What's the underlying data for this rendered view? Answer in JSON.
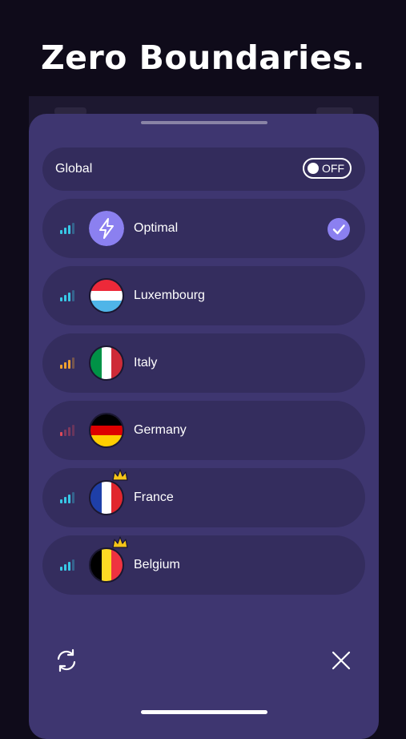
{
  "headline": "Zero Boundaries.",
  "global": {
    "label": "Global",
    "toggle_text": "OFF",
    "toggle_on": false
  },
  "servers": [
    {
      "name": "Optimal",
      "icon": "lightning-icon",
      "signal_color": "#38c8e6",
      "selected": true,
      "premium": false
    },
    {
      "name": "Luxembourg",
      "icon": "luxembourg-flag-icon",
      "signal_color": "#38c8e6",
      "selected": false,
      "premium": false
    },
    {
      "name": "Italy",
      "icon": "italy-flag-icon",
      "signal_color": "#f0a030",
      "selected": false,
      "premium": false
    },
    {
      "name": "Germany",
      "icon": "germany-flag-icon",
      "signal_color": "#e04a5a",
      "selected": false,
      "premium": false
    },
    {
      "name": "France",
      "icon": "france-flag-icon",
      "signal_color": "#38c8e6",
      "selected": false,
      "premium": true
    },
    {
      "name": "Belgium",
      "icon": "belgium-flag-icon",
      "signal_color": "#38c8e6",
      "selected": false,
      "premium": true
    }
  ],
  "colors": {
    "background": "#0f0b1a",
    "sheet": "#3e3670",
    "row": "#342d5e",
    "accent": "#8b80f0",
    "crown": "#f5c518"
  },
  "bottom_icons": [
    "refresh-icon",
    "close-icon"
  ]
}
